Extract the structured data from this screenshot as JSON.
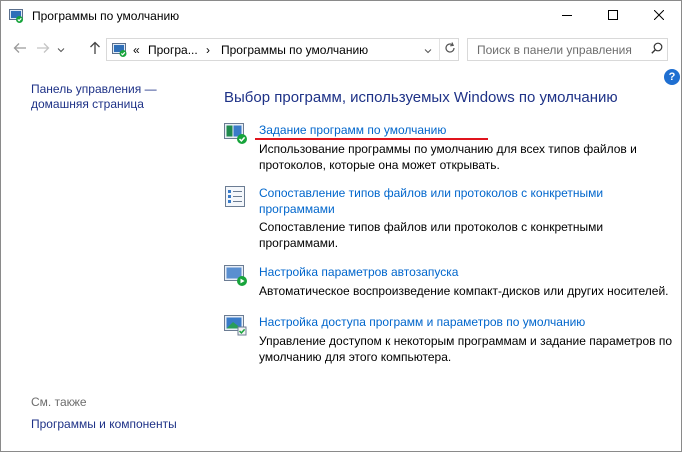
{
  "window": {
    "title": "Программы по умолчанию",
    "minimize_icon": "minimize-icon",
    "maximize_icon": "maximize-icon",
    "close_icon": "close-icon"
  },
  "address_bar": {
    "chevron": "«",
    "crumbs": [
      "Програ...",
      "Программы по умолчанию"
    ],
    "separator": "›",
    "search_placeholder": "Поиск в панели управления"
  },
  "help": {
    "label": "?"
  },
  "left_pane": {
    "home_link": "Панель управления — домашняя страница",
    "see_also_label": "См. также",
    "see_also_links": [
      "Программы и компоненты"
    ]
  },
  "main": {
    "title": "Выбор программ, используемых Windows по умолчанию",
    "tasks": [
      {
        "link": "Задание программ по умолчанию",
        "description": "Использование программы по умолчанию для всех типов файлов и протоколов, которые она может открывать.",
        "icon": "default-programs-icon"
      },
      {
        "link": "Сопоставление типов файлов или протоколов с конкретными программами",
        "description": "Сопоставление типов файлов или протоколов с конкретными программами.",
        "icon": "file-associations-icon"
      },
      {
        "link": "Настройка параметров автозапуска",
        "description": "Автоматическое воспроизведение компакт-дисков или других носителей.",
        "icon": "autoplay-icon"
      },
      {
        "link": "Настройка доступа программ и параметров по умолчанию",
        "description": "Управление доступом к некоторым программам и задание параметров по умолчанию для этого компьютера.",
        "icon": "program-access-icon"
      }
    ]
  },
  "colors": {
    "link": "#0066cc",
    "heading": "#1e3287",
    "highlight_underline": "#e0141d"
  }
}
